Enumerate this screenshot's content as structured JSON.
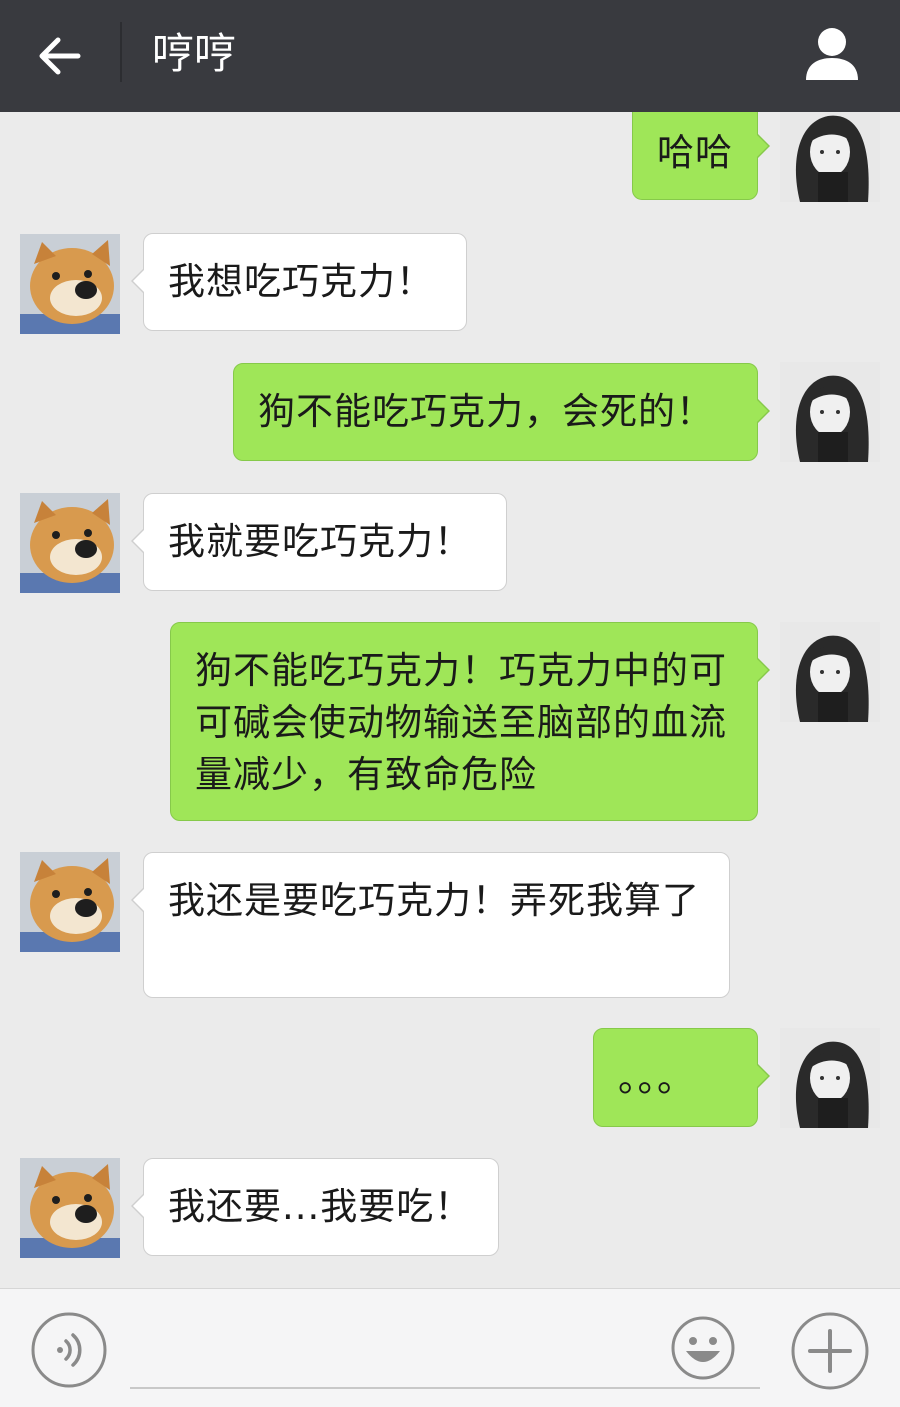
{
  "header": {
    "title": "哼哼",
    "back_icon": "arrow-left-icon",
    "profile_icon": "person-icon",
    "background_color": "#393a3f"
  },
  "messages": [
    {
      "side": "right",
      "sender": "girl",
      "text": "哈哈"
    },
    {
      "side": "left",
      "sender": "dog",
      "text": "我想吃巧克力！"
    },
    {
      "side": "right",
      "sender": "girl",
      "text": "狗不能吃巧克力，会死的！"
    },
    {
      "side": "left",
      "sender": "dog",
      "text": "我就要吃巧克力！"
    },
    {
      "side": "right",
      "sender": "girl",
      "text": "狗不能吃巧克力！巧克力中的可可碱会使动物输送至脑部的血流量减少，有致命危险"
    },
    {
      "side": "left",
      "sender": "dog",
      "text": "我还是要吃巧克力！弄死我算了"
    },
    {
      "side": "right",
      "sender": "girl",
      "text": "。。。"
    },
    {
      "side": "left",
      "sender": "dog",
      "text": "我还要...我要吃！"
    }
  ],
  "input_bar": {
    "voice_icon": "voice-icon",
    "emoji_icon": "smiley-icon",
    "plus_icon": "plus-icon",
    "input_value": ""
  },
  "colors": {
    "chat_background": "#ebebeb",
    "sent_bubble": "#9fe658",
    "received_bubble": "#ffffff"
  }
}
